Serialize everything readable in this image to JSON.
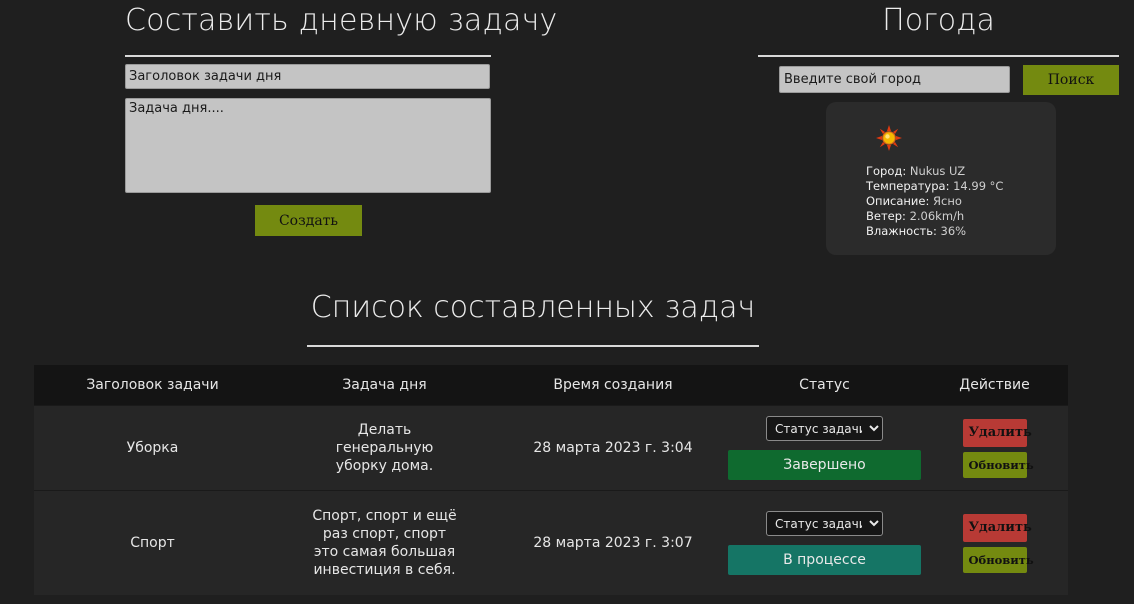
{
  "create": {
    "title": "Составить дневную задачу",
    "title_placeholder": "Заголовок задачи дня",
    "body_placeholder": "Задача дня....",
    "submit_label": "Создать"
  },
  "weather": {
    "title": "Погода",
    "city_placeholder": "Введите свой город",
    "search_label": "Поиск",
    "icon": "sun-icon",
    "city_label": "Город:",
    "city_value": "Nukus UZ",
    "temperature_label": "Температура:",
    "temperature_value": "14.99 °C",
    "description_label": "Описание:",
    "description_value": "Ясно",
    "wind_label": "Ветер:",
    "wind_value": "2.06km/h",
    "humidity_label": "Влажность:",
    "humidity_value": "36%"
  },
  "tasks": {
    "title": "Список составленных задач",
    "columns": [
      "Заголовок задачи",
      "Задача дня",
      "Время создания",
      "Статус",
      "Действие"
    ],
    "rows": [
      {
        "title": "Уборка",
        "body": "Делать генеральную уборку дома.",
        "created": "28 марта 2023 г. 3:04",
        "status_select": "Статус задачи",
        "status": "Завершено",
        "status_color": "#0f6a2f",
        "delete_label": "Удалить",
        "update_label": "Обновить"
      },
      {
        "title": "Спорт",
        "body": "Спорт, спорт и ещё раз спорт, спорт это самая большая инвестиция в себя.",
        "created": "28 марта 2023 г. 3:07",
        "status_select": "Статус задачи",
        "status": "В процессе",
        "status_color": "#157565",
        "delete_label": "Удалить",
        "update_label": "Обновить"
      }
    ]
  },
  "colors": {
    "background": "#1f1f1f",
    "accent_green": "#748a10",
    "delete_red": "#b83a35"
  }
}
